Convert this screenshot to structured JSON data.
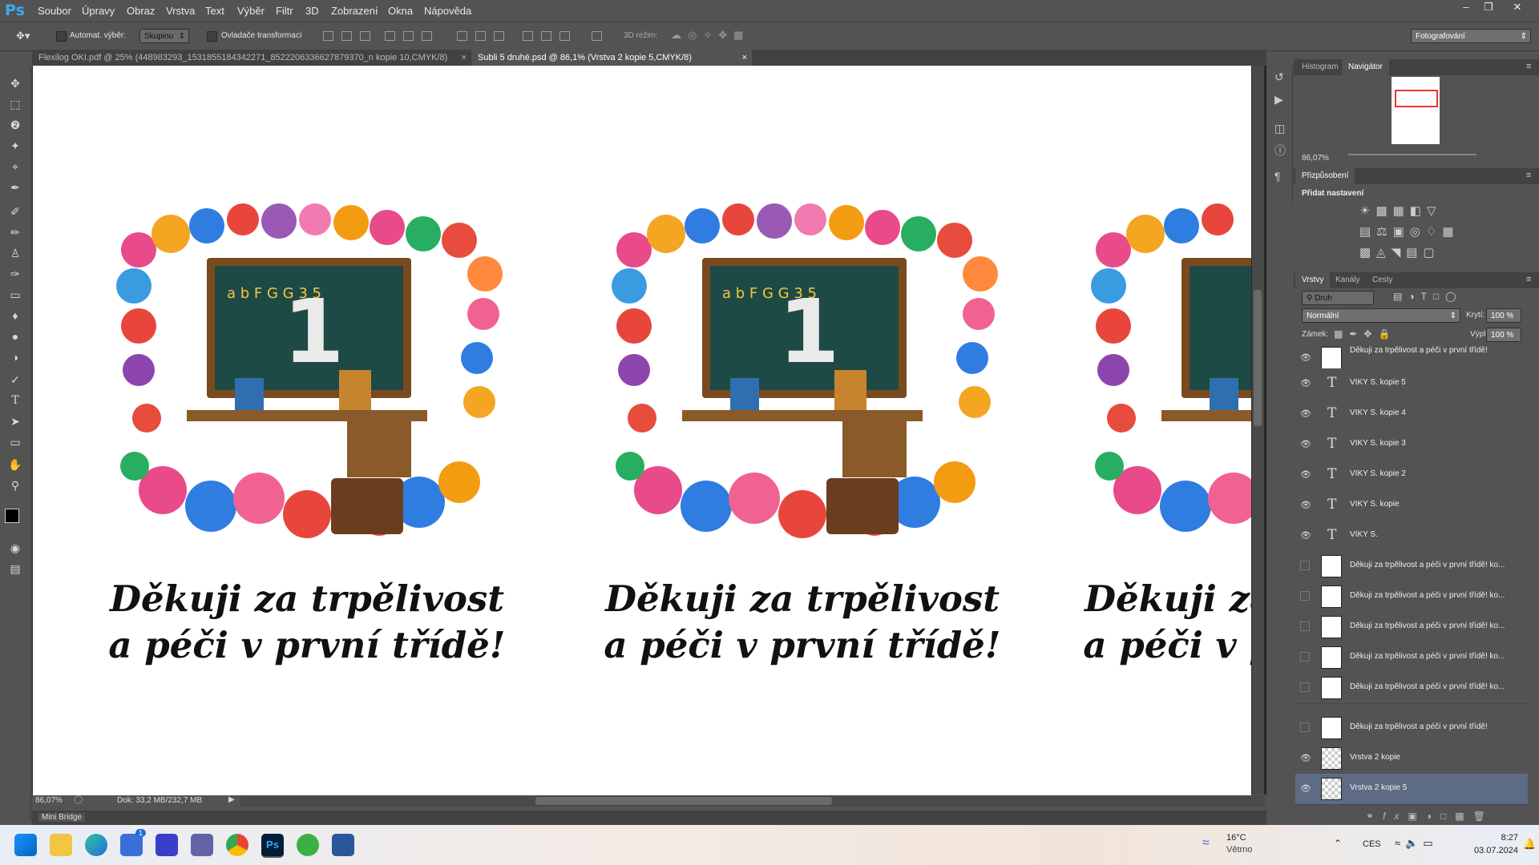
{
  "app": {
    "logo": "Ps"
  },
  "menu": [
    "Soubor",
    "Úpravy",
    "Obraz",
    "Vrstva",
    "Text",
    "Výběr",
    "Filtr",
    "3D",
    "Zobrazení",
    "Okna",
    "Nápověda"
  ],
  "window_controls": [
    "minimize-icon",
    "restore-icon",
    "close-icon"
  ],
  "options": {
    "auto_select_label": "Automat. výběr:",
    "auto_select_value": "Skupinu",
    "transform_label": "Ovladače transformací",
    "mode3d_label": "3D režim:",
    "workspace": "Fotografování"
  },
  "tabs": [
    {
      "label": "Flexilog OKI.pdf @ 25% (448983293_1531855184342271_8522206336627879370_n kopie 10,CMYK/8)",
      "active": false
    },
    {
      "label": "Subli 5 druhé.psd @ 86,1% (Vrstva 2 kopie 5,CMYK/8)",
      "active": true
    }
  ],
  "canvas": {
    "caption_line1": "Děkuji za trpělivost",
    "caption_line2": "a péči v první třídě!",
    "board_number": "1",
    "board_letters": "a b F G G 3 5",
    "cards_count": 3
  },
  "status": {
    "zoom": "86,07%",
    "doc": "Dok: 33,2 MB/232,7 MB"
  },
  "minibridge": "Mini Bridge",
  "navigator": {
    "tabs": [
      "Histogram",
      "Navigátor"
    ],
    "active": "Navigátor",
    "zoom": "86,07%"
  },
  "adjustments": {
    "tab": "Přizpůsobení",
    "title": "Přidat nastavení"
  },
  "layers_panel": {
    "tabs": [
      "Vrstvy",
      "Kanály",
      "Cesty"
    ],
    "filter": "Druh",
    "blend": "Normální",
    "opacity_label": "Krytí:",
    "opacity": "100 %",
    "lock_label": "Zámek:",
    "fill_label": "Výplň:",
    "fill": "100 %",
    "layers": [
      {
        "name": "Děkuji za trpělivost a péči v první třídě!",
        "type": "smart",
        "visible": true,
        "selected": false
      },
      {
        "name": "VIKY S. kopie 5",
        "type": "text",
        "visible": true,
        "selected": false
      },
      {
        "name": "VIKY S. kopie 4",
        "type": "text",
        "visible": true,
        "selected": false
      },
      {
        "name": "VIKY S. kopie 3",
        "type": "text",
        "visible": true,
        "selected": false
      },
      {
        "name": "VIKY S. kopie 2",
        "type": "text",
        "visible": true,
        "selected": false
      },
      {
        "name": "VIKY S. kopie",
        "type": "text",
        "visible": true,
        "selected": false
      },
      {
        "name": "VIKY S.",
        "type": "text",
        "visible": true,
        "selected": false
      },
      {
        "name": "Děkuji za trpělivost a péči v první třídě! ko...",
        "type": "smart",
        "visible": false,
        "selected": false
      },
      {
        "name": "Děkuji za trpělivost a péči v první třídě! ko...",
        "type": "smart",
        "visible": false,
        "selected": false
      },
      {
        "name": "Děkuji za trpělivost a péči v první třídě! ko...",
        "type": "smart",
        "visible": false,
        "selected": false
      },
      {
        "name": "Děkuji za trpělivost a péči v první třídě! ko...",
        "type": "smart",
        "visible": false,
        "selected": false
      },
      {
        "name": "Děkuji za trpělivost a péči v první třídě! ko...",
        "type": "smart",
        "visible": false,
        "selected": false
      },
      {
        "name": "Děkuji za trpělivost a péči v první třídě!",
        "type": "smart",
        "visible": false,
        "selected": false
      },
      {
        "name": "Vrstva 2 kopie",
        "type": "pixel",
        "visible": true,
        "selected": false
      },
      {
        "name": "Vrstva 2 kopie 5",
        "type": "pixel",
        "visible": true,
        "selected": true
      }
    ]
  },
  "taskbar": {
    "weather_temp": "16°C",
    "weather_desc": "Větrno",
    "lang": "CES",
    "time": "8:27",
    "date": "03.07.2024",
    "store_badge": "1"
  },
  "colors": {
    "accent": "#3fa9f5",
    "panel": "#535353",
    "selected_layer": "#5d6b85"
  }
}
